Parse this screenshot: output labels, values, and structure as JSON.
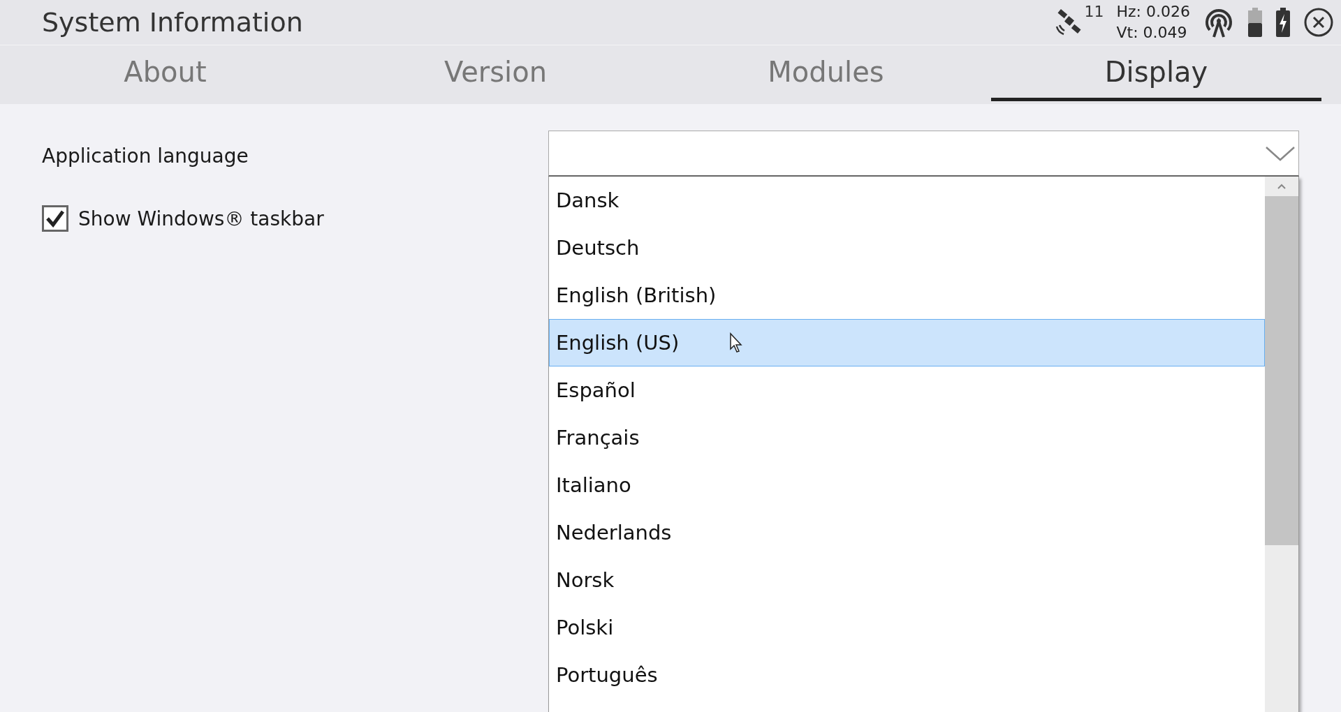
{
  "window": {
    "title": "System Information"
  },
  "status": {
    "satellites": "11",
    "hz": "Hz: 0.026",
    "vt": "Vt: 0.049"
  },
  "tabs": [
    {
      "label": "About",
      "selected": false
    },
    {
      "label": "Version",
      "selected": false
    },
    {
      "label": "Modules",
      "selected": false
    },
    {
      "label": "Display",
      "selected": true
    }
  ],
  "settings": {
    "language_label": "Application language",
    "taskbar": {
      "label": "Show Windows® taskbar",
      "checked": true
    }
  },
  "language_dropdown": {
    "expanded": true,
    "options": [
      {
        "label": "Dansk",
        "selected": false
      },
      {
        "label": "Deutsch",
        "selected": false
      },
      {
        "label": "English (British)",
        "selected": false
      },
      {
        "label": "English (US)",
        "selected": true
      },
      {
        "label": "Español",
        "selected": false
      },
      {
        "label": "Français",
        "selected": false
      },
      {
        "label": "Italiano",
        "selected": false
      },
      {
        "label": "Nederlands",
        "selected": false
      },
      {
        "label": "Norsk",
        "selected": false
      },
      {
        "label": "Polski",
        "selected": false
      },
      {
        "label": "Português",
        "selected": false
      }
    ]
  }
}
